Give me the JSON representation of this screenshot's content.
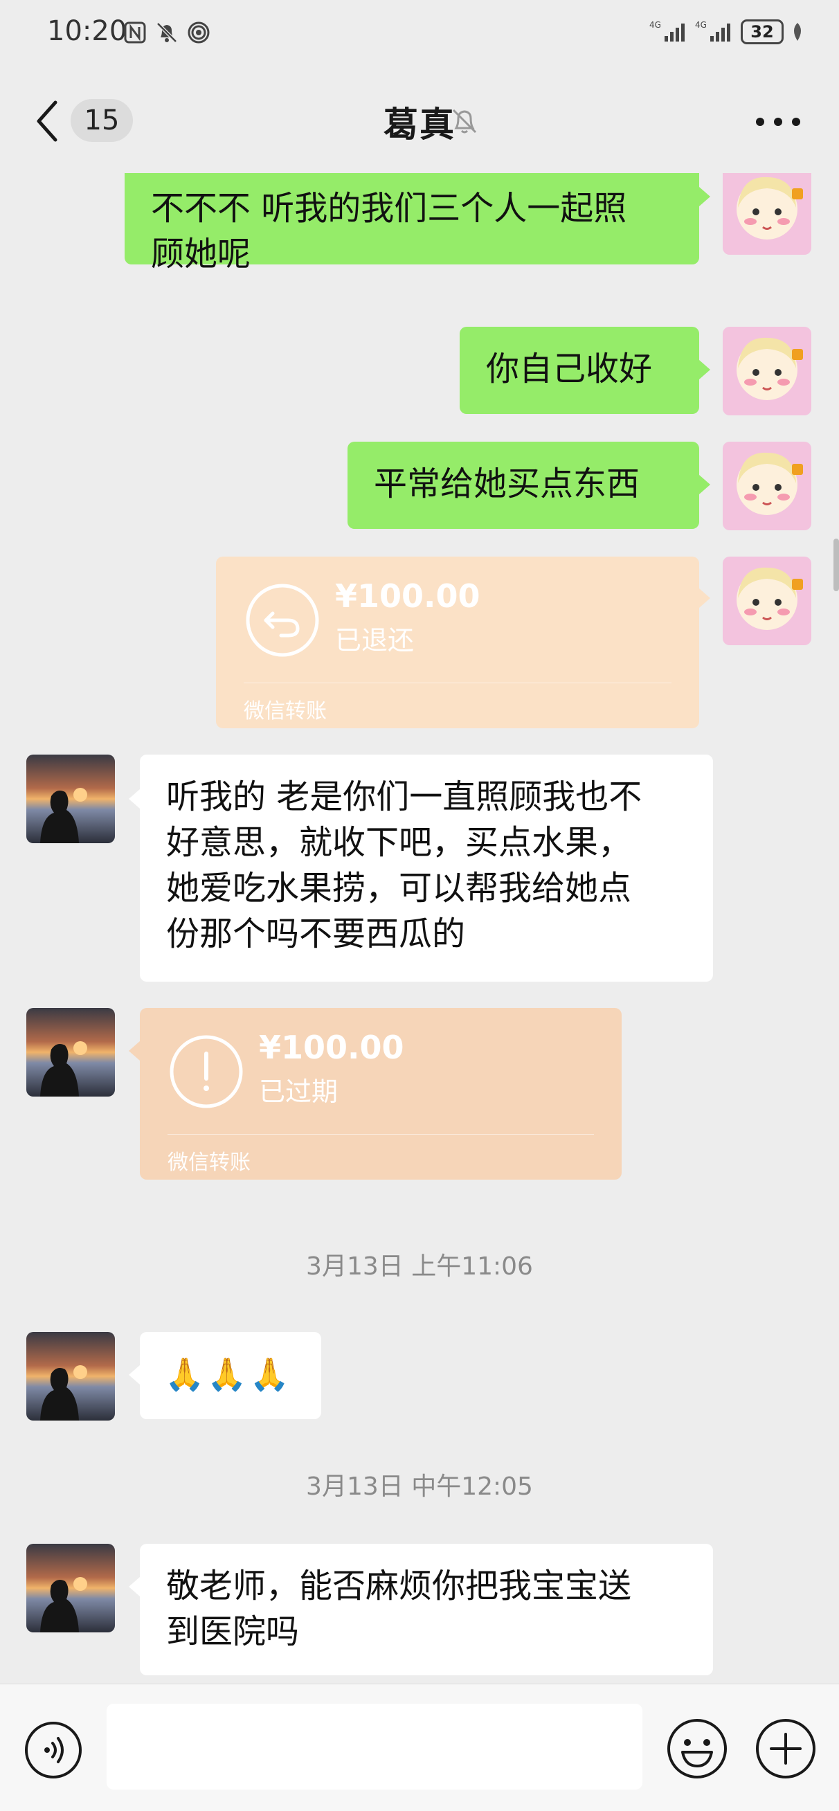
{
  "status_bar": {
    "time": "10:20",
    "battery": "32",
    "signal1": "4G",
    "signal2": "4G"
  },
  "nav": {
    "back_badge": "15",
    "title": "葛真",
    "muted": true
  },
  "messages": [
    {
      "sender": "me",
      "type": "text",
      "lines": [
        "不不不 听我的我们三个人一起照",
        "顾她呢"
      ]
    },
    {
      "sender": "me",
      "type": "text",
      "lines": [
        "你自己收好"
      ]
    },
    {
      "sender": "me",
      "type": "text",
      "lines": [
        "平常给她买点东西"
      ]
    },
    {
      "sender": "me",
      "type": "transfer",
      "amount": "¥100.00",
      "status": "已退还",
      "label": "微信转账"
    },
    {
      "sender": "other",
      "type": "text",
      "lines": [
        "听我的 老是你们一直照顾我也不",
        "好意思，就收下吧，买点水果，",
        "她爱吃水果捞，可以帮我给她点",
        "份那个吗不要西瓜的"
      ]
    },
    {
      "sender": "other",
      "type": "transfer",
      "amount": "¥100.00",
      "status": "已过期",
      "label": "微信转账"
    },
    {
      "sender": "other",
      "type": "emoji",
      "text": "🙏🙏🙏"
    },
    {
      "sender": "other",
      "type": "text",
      "lines": [
        "敬老师，能否麻烦你把我宝宝送",
        "到医院吗"
      ]
    }
  ],
  "timestamps": [
    "3月13日 上午11:06",
    "3月13日 中午12:05"
  ],
  "input_bar": {
    "placeholder": ""
  },
  "colors": {
    "background": "#ededed",
    "bubble_me": "#95ec69",
    "bubble_other": "#ffffff",
    "transfer_refunded": "#fbe1c6",
    "transfer_expired": "#f6d5b8"
  },
  "icons": {
    "back": "chevron-left-icon",
    "mute": "bell-off-icon",
    "more": "more-dots-icon",
    "voice": "voice-icon",
    "emoji": "emoji-icon",
    "plus": "plus-icon",
    "refund": "return-arrow-icon",
    "expired": "exclamation-icon"
  }
}
